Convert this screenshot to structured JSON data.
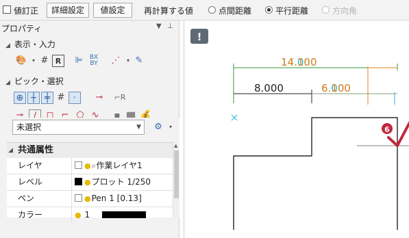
{
  "toolbar": {
    "value_correct_label": "値訂正",
    "detail_settings_label": "詳細設定",
    "value_settings_label": "値設定",
    "recalc_label": "再計算する値",
    "radio_point_distance": "点間距離",
    "radio_parallel_distance": "平行距離",
    "radio_direction_angle": "方向角"
  },
  "panel": {
    "title": "プロパティ",
    "section_display_input": "表示・入力",
    "section_pick_select": "ピック・選択"
  },
  "props": {
    "selection_value": "未選択",
    "group_header": "共通属性",
    "rows": [
      {
        "key": "レイヤ",
        "value": "作業レイヤ1"
      },
      {
        "key": "レベル",
        "value": "プロット 1/250"
      },
      {
        "key": "ペン",
        "value": "Pen 1 [0.13]"
      },
      {
        "key": "カラー",
        "value": "1"
      }
    ]
  },
  "canvas": {
    "dim_total_orange": "14.100",
    "dim_total_cyan": "14.000",
    "dim_left": "8.000",
    "dim_right_orange": "6.100",
    "dim_right_cyan": "6.000",
    "badge_number": "6"
  },
  "colors": {
    "orange": "#e8821c",
    "cyan": "#1fb6d6",
    "dark_dim": "#222222",
    "badge": "#c0283c",
    "info_icon_bg": "#5f6a75"
  }
}
